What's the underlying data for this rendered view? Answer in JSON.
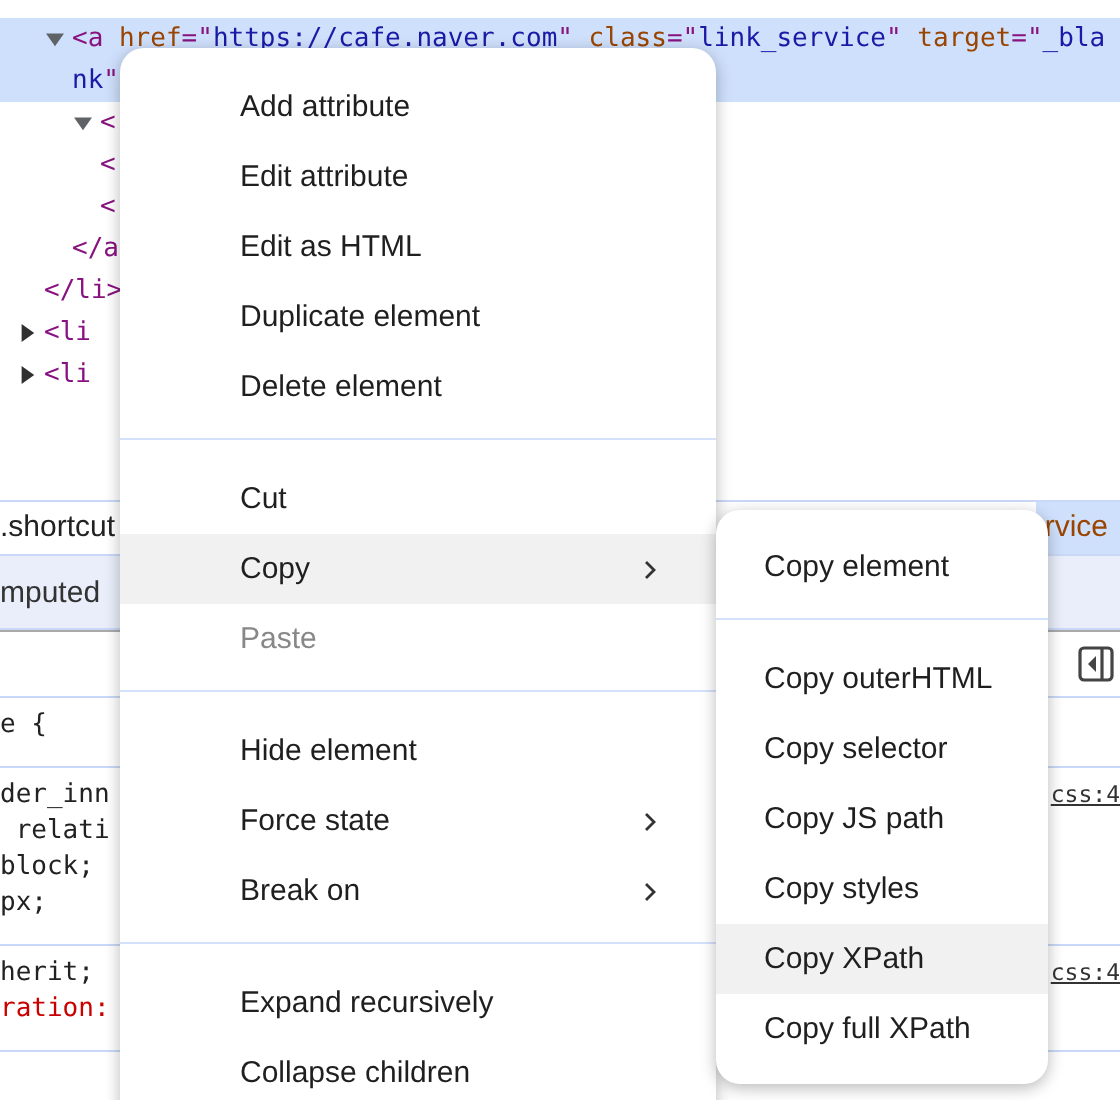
{
  "dom_tree": [
    {
      "closing": "</li>",
      "children": [
        {
          "expanded": true,
          "selected": true,
          "segments": [
            {
              "kind": "tag",
              "text": "<a"
            },
            {
              "kind": "attr",
              "text": " href"
            },
            {
              "kind": "punct",
              "text": "=\""
            },
            {
              "kind": "value",
              "text": "https://cafe.naver.com"
            },
            {
              "kind": "punct",
              "text": "\""
            },
            {
              "kind": "attr",
              "text": " class"
            },
            {
              "kind": "punct",
              "text": "=\""
            },
            {
              "kind": "value",
              "text": "link_service"
            },
            {
              "kind": "punct",
              "text": "\""
            },
            {
              "kind": "attr",
              "text": " target"
            },
            {
              "kind": "punct",
              "text": "=\""
            },
            {
              "kind": "value",
              "text": "_bla"
            }
          ],
          "wrap_segments": [
            {
              "kind": "value",
              "text": "nk"
            },
            {
              "kind": "punct",
              "text": "\""
            }
          ],
          "children": [
            {
              "expanded": true,
              "selected": false,
              "segments": [
                {
                  "kind": "tag",
                  "text": "<"
                }
              ]
            },
            {
              "selected": false,
              "segments": [
                {
                  "kind": "tag",
                  "text": "<"
                }
              ]
            },
            {
              "selected": false,
              "segments": [
                {
                  "kind": "tag",
                  "text": "<"
                }
              ]
            }
          ],
          "closing": "</a"
        }
      ]
    },
    {
      "expanded": false,
      "selected": false,
      "segments": [
        {
          "kind": "tag",
          "text": "<li"
        }
      ]
    },
    {
      "expanded": false,
      "selected": false,
      "segments": [
        {
          "kind": "tag",
          "text": "<li"
        }
      ]
    }
  ],
  "breadcrumb": [
    {
      "label": ".shortcut",
      "selected": false
    },
    {
      "label": "rvice",
      "selected": true
    }
  ],
  "styles_tab": "mputed",
  "rules": [
    {
      "lines": [
        {
          "kind": "plain",
          "text": "e {"
        }
      ]
    },
    {
      "source": "css:4",
      "lines": [
        {
          "kind": "plain",
          "text": "der_inn"
        },
        {
          "kind": "plain",
          "text": " relati"
        },
        {
          "kind": "plain",
          "text": "block;"
        },
        {
          "kind": "plain",
          "text": "px;"
        }
      ]
    },
    {
      "source": "css:4",
      "lines": [
        {
          "kind": "plain",
          "text": "herit;"
        },
        {
          "kind": "property",
          "text": "ration:"
        }
      ]
    }
  ],
  "context_menu": {
    "groups": [
      [
        {
          "label": "Add attribute",
          "selected": false,
          "disabled": false,
          "submenu": false
        },
        {
          "label": "Edit attribute",
          "selected": false,
          "disabled": false,
          "submenu": false
        },
        {
          "label": "Edit as HTML",
          "selected": false,
          "disabled": false,
          "submenu": false
        },
        {
          "label": "Duplicate element",
          "selected": false,
          "disabled": false,
          "submenu": false
        },
        {
          "label": "Delete element",
          "selected": false,
          "disabled": false,
          "submenu": false
        }
      ],
      [
        {
          "label": "Cut",
          "selected": false,
          "disabled": false,
          "submenu": false
        },
        {
          "label": "Copy",
          "selected": true,
          "disabled": false,
          "submenu": true
        },
        {
          "label": "Paste",
          "selected": false,
          "disabled": true,
          "submenu": false
        }
      ],
      [
        {
          "label": "Hide element",
          "selected": false,
          "disabled": false,
          "submenu": false
        },
        {
          "label": "Force state",
          "selected": false,
          "disabled": false,
          "submenu": true
        },
        {
          "label": "Break on",
          "selected": false,
          "disabled": false,
          "submenu": true
        }
      ],
      [
        {
          "label": "Expand recursively",
          "selected": false,
          "disabled": false,
          "submenu": false
        },
        {
          "label": "Collapse children",
          "selected": false,
          "disabled": false,
          "submenu": false
        }
      ]
    ]
  },
  "copy_submenu": {
    "groups": [
      [
        {
          "label": "Copy element",
          "selected": false
        }
      ],
      [
        {
          "label": "Copy outerHTML",
          "selected": false
        },
        {
          "label": "Copy selector",
          "selected": false
        },
        {
          "label": "Copy JS path",
          "selected": false
        },
        {
          "label": "Copy styles",
          "selected": false
        },
        {
          "label": "Copy XPath",
          "selected": true
        },
        {
          "label": "Copy full XPath",
          "selected": false
        }
      ]
    ]
  }
}
